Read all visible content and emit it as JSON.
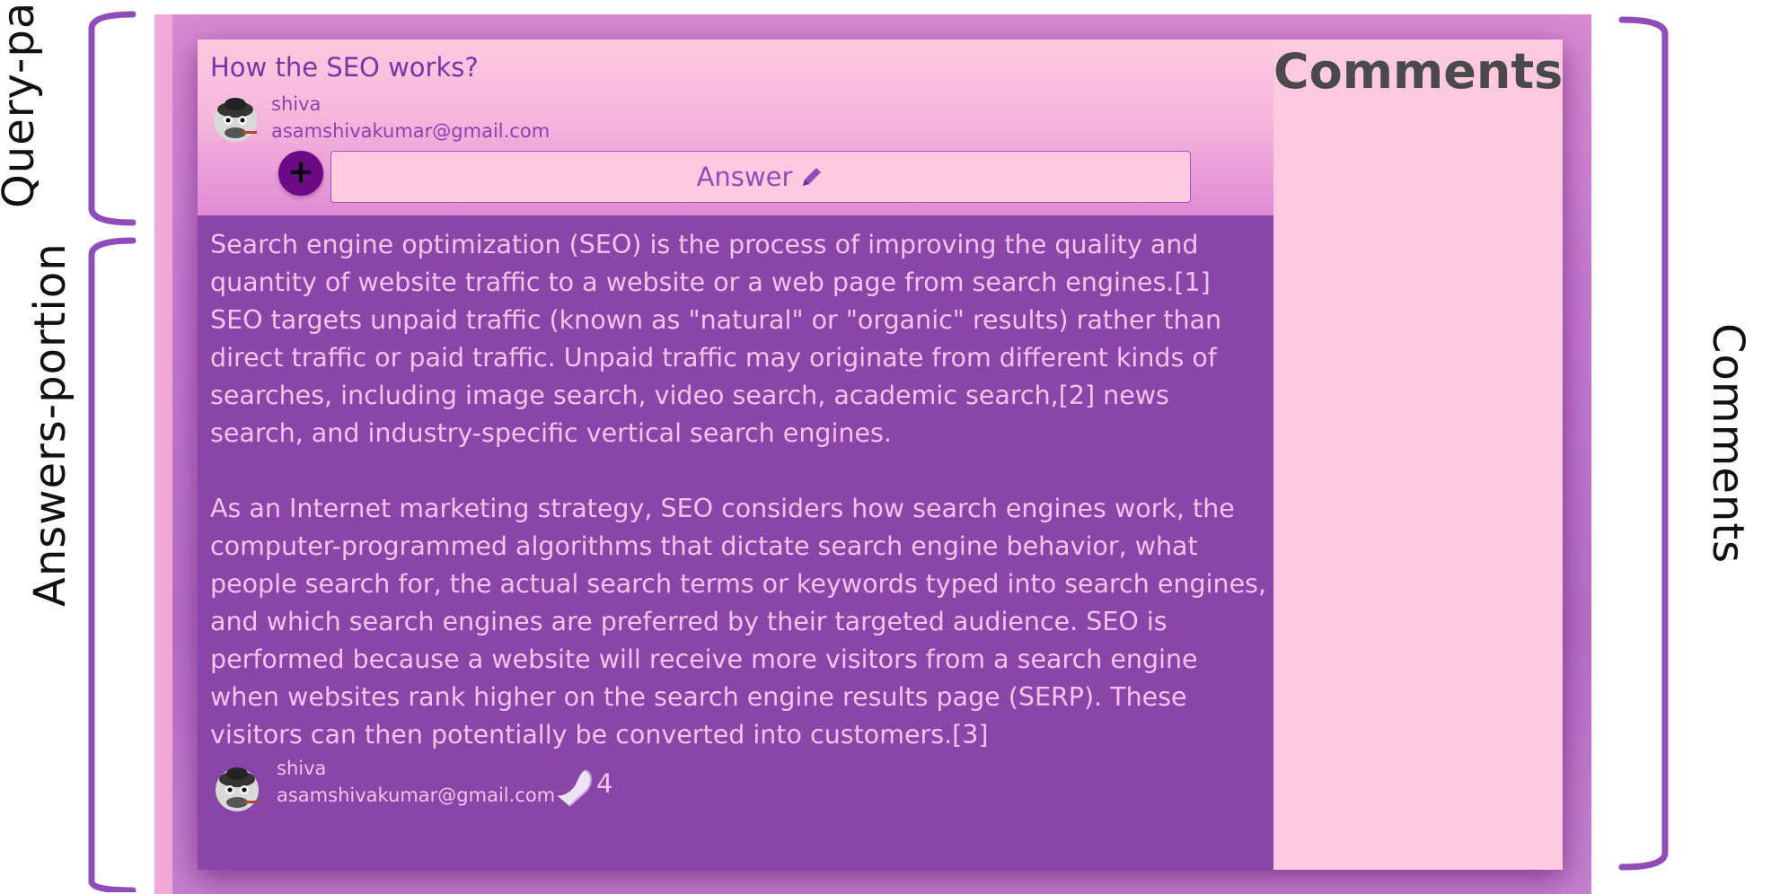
{
  "annotations": {
    "query_label": "Query-part",
    "answers_label": "Answers-portion",
    "comments_label": "Comments"
  },
  "query": {
    "title": "How the SEO works?",
    "user_name": "shiva",
    "user_email": "asamshivakumar@gmail.com",
    "add_button_icon": "plus-icon",
    "answer_button_label": "Answer",
    "answer_button_icon": "pencil-icon"
  },
  "answer": {
    "paragraphs": [
      " Search engine optimization (SEO) is the process of improving the quality and quantity of website traffic to a website or a web page from search engines.[1] SEO targets unpaid traffic (known as \"natural\" or \"organic\" results) rather than direct traffic or paid traffic. Unpaid traffic may originate from different kinds of searches, including image search, video search, academic search,[2] news search, and industry-specific vertical search engines.",
      "As an Internet marketing strategy, SEO considers how search engines work, the computer-programmed algorithms that dictate search engine behavior, what people search for, the actual search terms or keywords typed into search engines, and which search engines are preferred by their targeted audience. SEO is performed because a website will receive more visitors from a search engine when websites rank higher on the search engine results page (SERP). These visitors can then potentially be converted into customers.[3]"
    ],
    "user_name": "shiva",
    "user_email": "asamshivakumar@gmail.com",
    "like_icon": "heart-icon",
    "like_count": "4"
  },
  "comments": {
    "title": "Comments"
  },
  "colors": {
    "frame": "#c57ad0",
    "query_bg": "#ffc9df",
    "answers_bg": "#8a45a9",
    "answer_text": "#f3c3e9",
    "comments_bg": "#ffc9df",
    "bracket": "#8e4db8",
    "add_button": "#6c0a86"
  }
}
